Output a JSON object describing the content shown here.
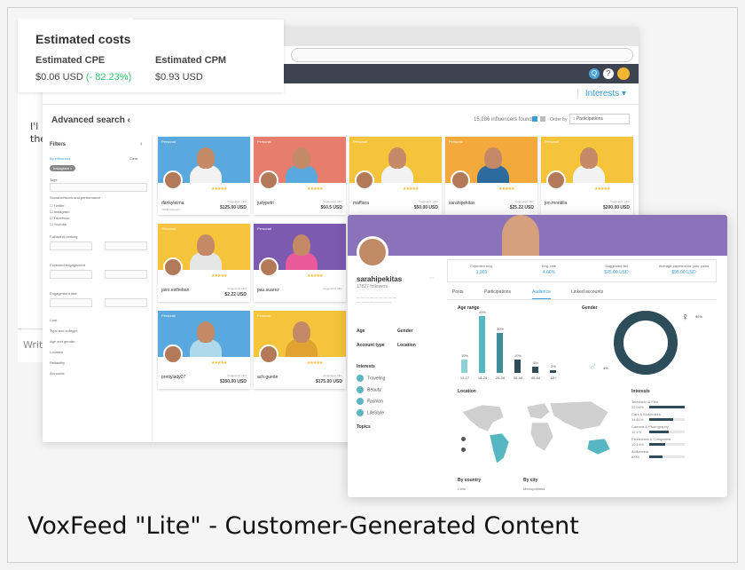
{
  "caption": "VoxFeed \"Lite\" - Customer-Generated Content",
  "background_page": {
    "snippet1": "I'l",
    "snippet2": "the",
    "snippet3": "Writ"
  },
  "costs": {
    "title": "Estimated costs",
    "cpe_label": "Estimated CPE",
    "cpe_value": "$0.06 USD",
    "cpe_change": "(- 82.23%)",
    "cpm_label": "Estimated CPM",
    "cpm_value": "$0.93 USD"
  },
  "app": {
    "interests_tab": "Interests",
    "advanced_search": "Advanced search",
    "found": "15,286 influencers found",
    "order_by": "Order by",
    "order_value": "↕ Participations"
  },
  "filters": {
    "title": "Filters",
    "by_influencer": "By influencer",
    "clear": "Clear",
    "chip": "Instagram",
    "tags": "Tags",
    "social_network": "Social network and performance",
    "networks": [
      "Twitter",
      "Instagram",
      "Facebook",
      "Youtube"
    ],
    "followers_ranking": "Followers ranking",
    "expected_engagement": "Expected engagement",
    "engagement_rate": "Engagement rate",
    "more": [
      "Cost",
      "Type and subtype",
      "Age and gender",
      "Location",
      "Reliability",
      "Accounts"
    ]
  },
  "cards": [
    {
      "tag": "Personal",
      "name": "dankyleirna",
      "followers": "72645 followers",
      "offer_label": "Suggestion offer",
      "price": "$125.00 USD",
      "bg": "#5aa9de",
      "shirt": "#f2f2f2"
    },
    {
      "tag": "Personal",
      "name": "judypetri",
      "followers": "",
      "offer_label": "Suggestion offer",
      "price": "$60.5 USD",
      "bg": "#e67d6d",
      "shirt": "#5aa9de"
    },
    {
      "tag": "Personal",
      "name": "maffiara",
      "followers": "",
      "offer_label": "Suggestion offer",
      "price": "$50.00 USD",
      "bg": "#f6c43b",
      "shirt": "#f2f2f2"
    },
    {
      "tag": "Personal",
      "name": "sarahipekitas",
      "followers": "",
      "offer_label": "Suggestion offer",
      "price": "$25.22 USD",
      "bg": "#f4a93c",
      "shirt": "#2d6b9e"
    },
    {
      "tag": "Personal",
      "name": "jon.montilla",
      "followers": "",
      "offer_label": "Suggestion offer",
      "price": "$200.00 USD",
      "bg": "#f6c43b",
      "shirt": "#f2f2f2"
    },
    {
      "tag": "Personal",
      "name": "jairo.estheban",
      "followers": "",
      "offer_label": "Suggestion offer",
      "price": "$2.22 USD",
      "bg": "#f6c43b",
      "shirt": "#e6e6e6"
    },
    {
      "tag": "Personal",
      "name": "pau.suarez",
      "followers": "",
      "offer_label": "Suggestion offer",
      "price": "",
      "bg": "#7b5ab0",
      "shirt": "#e85a9a"
    },
    {
      "tag": "Personal",
      "name": "prettylady07",
      "followers": "",
      "offer_label": "Suggestion offer",
      "price": "$350.00 USD",
      "bg": "#5aa9de",
      "shirt": "#b0d8ec"
    },
    {
      "tag": "Personal",
      "name": "ach.guede",
      "followers": "",
      "offer_label": "Suggestion offer",
      "price": "$175.00 USD",
      "bg": "#f6c43b",
      "shirt": "#e0a330"
    }
  ],
  "profile": {
    "name": "sarahipekitas",
    "followers": "17827 followers",
    "stats": [
      {
        "label": "Expected eng.",
        "value": "1,005"
      },
      {
        "label": "Eng. rate",
        "value": "4.66%"
      },
      {
        "label": "Suggested bid",
        "value": "$75.00 USD"
      },
      {
        "label": "Average payment for your posts",
        "value": "$95.00 USD"
      }
    ],
    "tabs": [
      "Posts",
      "Participations",
      "Audience",
      "Linked accounts"
    ],
    "active_tab": "Audience",
    "age_range_label": "Age range",
    "gender_label": "Gender",
    "location_label": "Location",
    "interests_label": "Interests",
    "by_country": "By country",
    "by_city": "By city",
    "left_col": {
      "age": "Age",
      "gender": "Gender",
      "account_type": "Account type",
      "location": "Location",
      "interests": "Interests",
      "topics": "Topics",
      "interest_items": [
        "Traveling",
        "Beauty",
        "Fashion",
        "LifeStyle"
      ]
    },
    "age_bars": [
      {
        "label": "13-17",
        "value": 10,
        "value_text": "10%"
      },
      {
        "label": "18-24",
        "value": 43,
        "value_text": "43%"
      },
      {
        "label": "25-34",
        "value": 30,
        "value_text": "30%"
      },
      {
        "label": "35-44",
        "value": 10,
        "value_text": "10%"
      },
      {
        "label": "45-64",
        "value": 5,
        "value_text": "5%"
      },
      {
        "label": "65+",
        "value": 2,
        "value_text": "2%"
      }
    ],
    "gender_male": "4%",
    "gender_female": "96%",
    "audience_interests": [
      {
        "label": "Television & Film",
        "pct": "22.04%",
        "value": 22
      },
      {
        "label": "Cars & Motorbikes",
        "pct": "14.61%",
        "value": 15
      },
      {
        "label": "Camera & Photography",
        "pct": "12.1%",
        "value": 12
      },
      {
        "label": "Electronics & Computers",
        "pct": "10.14%",
        "value": 10
      },
      {
        "label": "Activewear",
        "pct": "8.0%",
        "value": 8
      }
    ],
    "country_first": "Chile",
    "city_first": "Metropolitana"
  }
}
